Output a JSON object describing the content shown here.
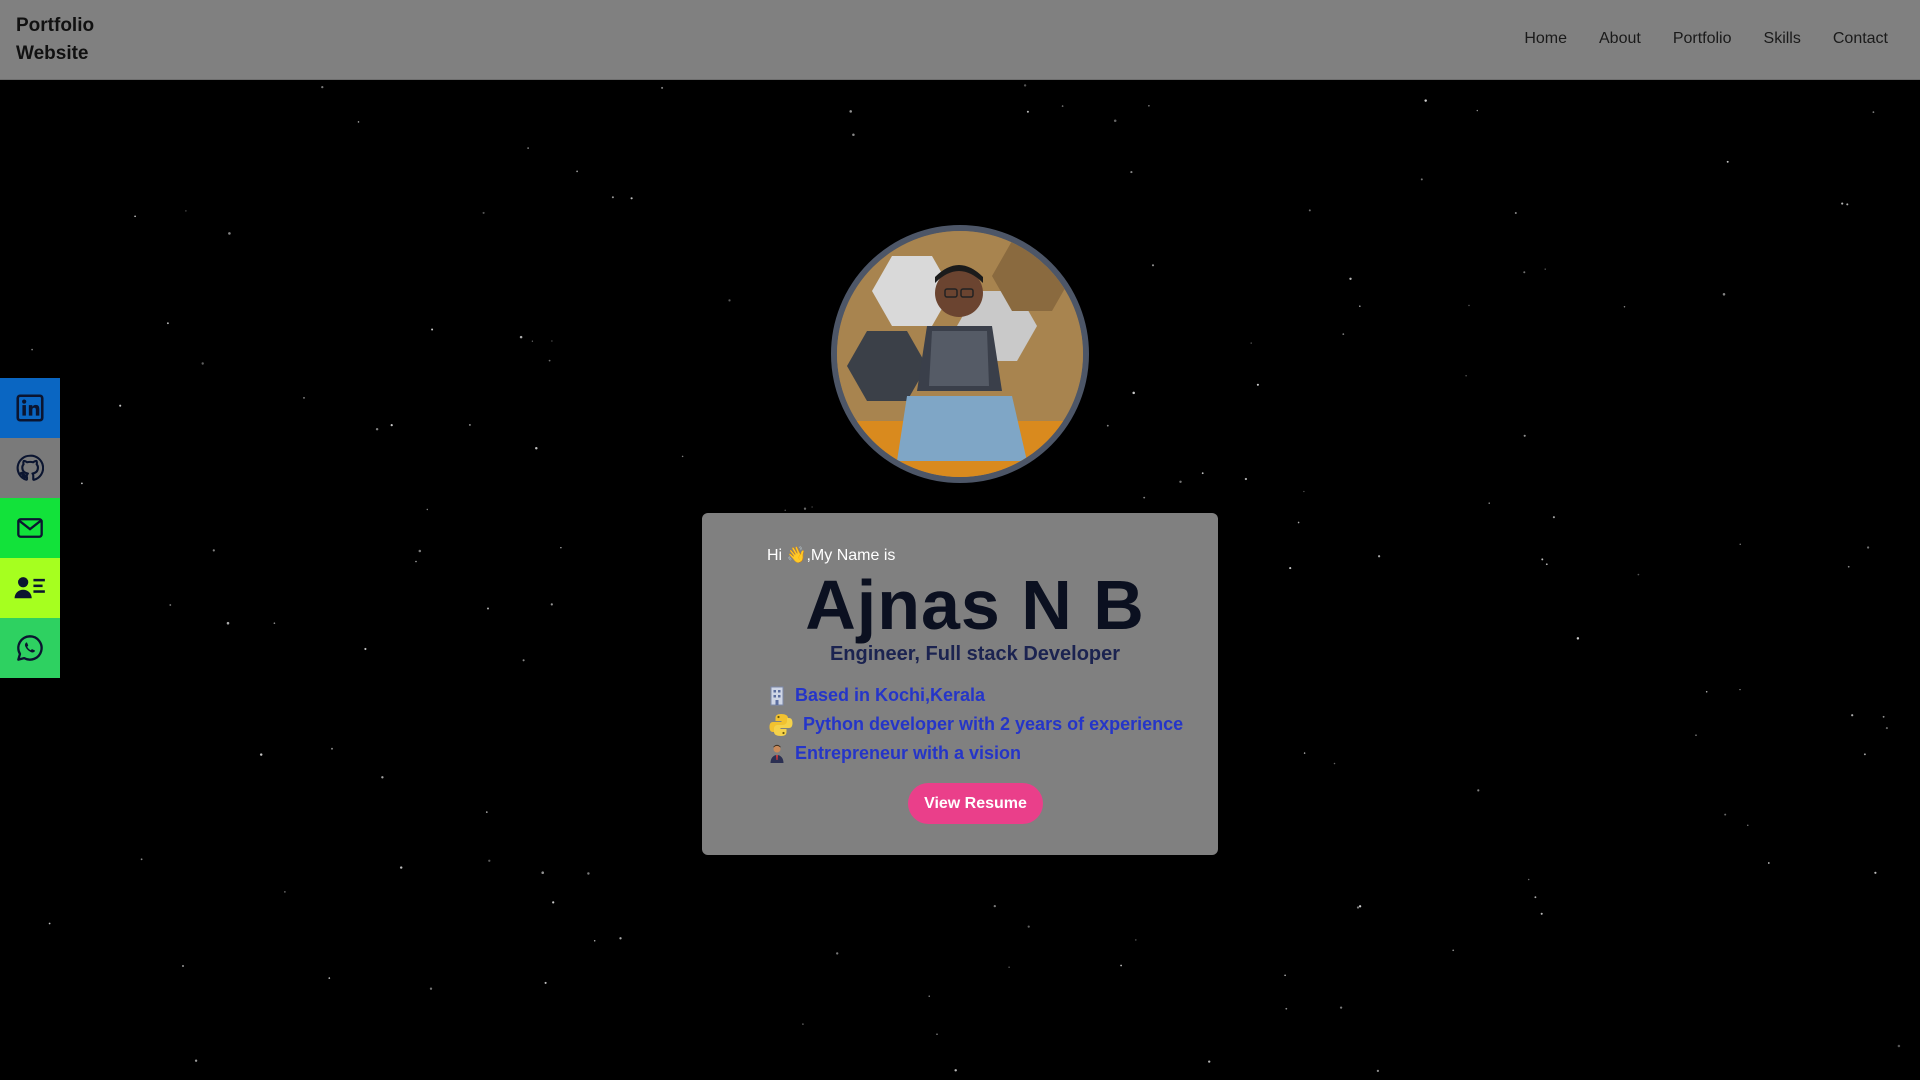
{
  "navbar": {
    "brand_line1": "Portfolio",
    "brand_line2": "Website",
    "links": [
      "Home",
      "About",
      "Portfolio",
      "Skills",
      "Contact"
    ]
  },
  "social": [
    {
      "icon": "linkedin-icon",
      "color": "#0a66c2"
    },
    {
      "icon": "github-icon",
      "color": "#7a7a7a"
    },
    {
      "icon": "mail-icon",
      "color": "#12e23a"
    },
    {
      "icon": "contact-card-icon",
      "color": "#a6ff1f"
    },
    {
      "icon": "whatsapp-icon",
      "color": "#2ed161"
    }
  ],
  "hero": {
    "greeting": "Hi 👋,My Name is",
    "name": "Ajnas N B",
    "role": "Engineer, Full stack Developer",
    "facts": [
      {
        "icon": "building-icon",
        "text": "Based in Kochi,Kerala"
      },
      {
        "icon": "python-icon",
        "text": "Python developer with 2 years of experience"
      },
      {
        "icon": "businessman-icon",
        "text": "Entrepreneur with a vision"
      }
    ],
    "button_label": "View Resume"
  },
  "colors": {
    "navbar_bg": "#808080",
    "card_bg": "#808080",
    "accent_button": "#ea3f8a",
    "fact_text": "#2535c8"
  }
}
